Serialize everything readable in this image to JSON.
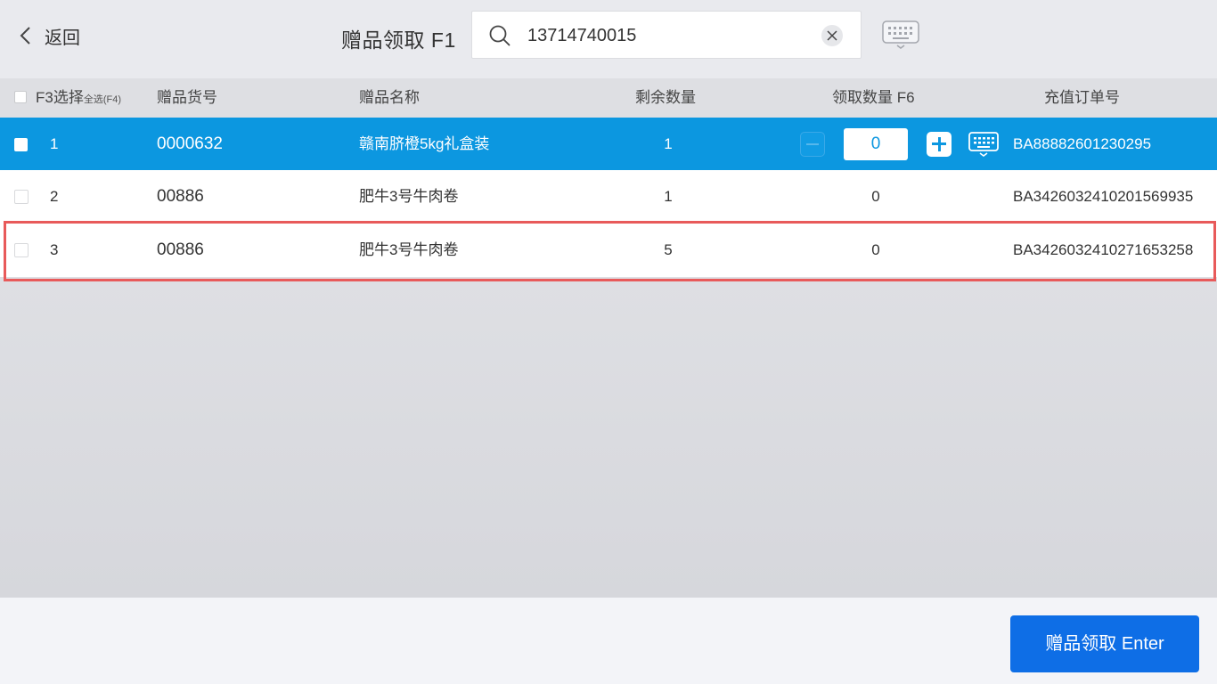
{
  "header": {
    "back_label": "返回",
    "title": "赠品领取 F1",
    "search_value": "13714740015"
  },
  "table": {
    "columns": {
      "select": "F3选择",
      "select_all": "全选(F4)",
      "code": "赠品货号",
      "name": "赠品名称",
      "remaining": "剩余数量",
      "claim_qty": "领取数量 F6",
      "order_no": "充值订单号"
    },
    "rows": [
      {
        "index": "1",
        "code": "0000632",
        "name": "赣南脐橙5kg礼盒装",
        "remaining": "1",
        "claim_qty": "0",
        "order_no": "BA88882601230295",
        "selected": true
      },
      {
        "index": "2",
        "code": "00886",
        "name": "肥牛3号牛肉卷",
        "remaining": "1",
        "claim_qty": "0",
        "order_no": "BA3426032410201569935",
        "selected": false
      },
      {
        "index": "3",
        "code": "00886",
        "name": "肥牛3号牛肉卷",
        "remaining": "5",
        "claim_qty": "0",
        "order_no": "BA3426032410271653258",
        "selected": false
      }
    ]
  },
  "footer": {
    "submit_label": "赠品领取 Enter"
  },
  "colors": {
    "selected_row": "#0c97e0",
    "primary_button": "#0e6ee6",
    "highlight_border": "#e85a5a"
  }
}
